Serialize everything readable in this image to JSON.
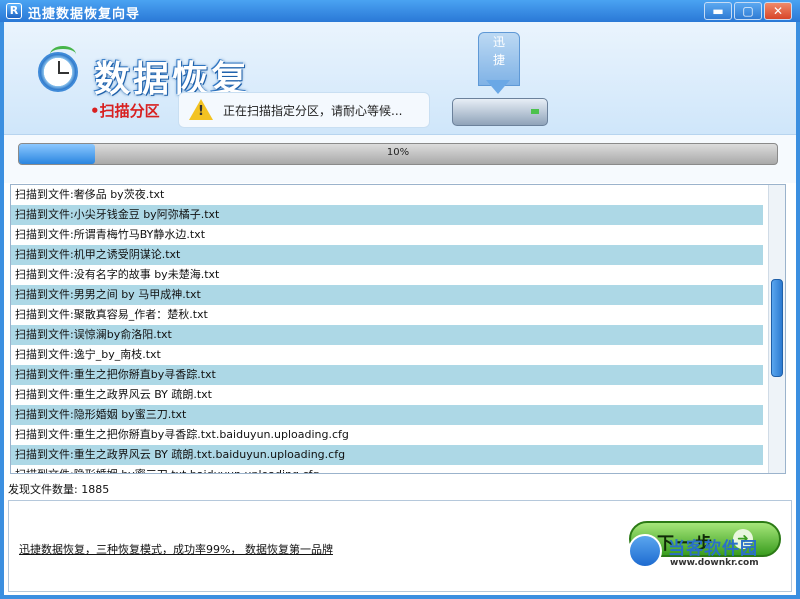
{
  "window": {
    "title": "迅捷数据恢复向导",
    "icon_letter": "R",
    "controls": {
      "minimize": "▬",
      "maximize": "▢",
      "close": "✕"
    }
  },
  "header": {
    "big_title": "数据恢复",
    "sub_title": "•扫描分区",
    "status_message": "正在扫描指定分区，请耐心等候...",
    "drive_sign": "迅\n捷"
  },
  "progress": {
    "value": 0.1,
    "label": "10%"
  },
  "log": {
    "rows": [
      "扫描到文件:奢侈品 by茨夜.txt",
      "扫描到文件:小尖牙钱金豆 by阿弥橘子.txt",
      "扫描到文件:所谓青梅竹马BY静水边.txt",
      "扫描到文件:机甲之诱受阴谋论.txt",
      "扫描到文件:没有名字的故事 by未楚海.txt",
      "扫描到文件:男男之间 by 马甲成神.txt",
      "扫描到文件:聚散真容易_作者：楚秋.txt",
      "扫描到文件:误惊澜by俞洛阳.txt",
      "扫描到文件:逸宁_by_南枝.txt",
      "扫描到文件:重生之把你掰直by寻香踪.txt",
      "扫描到文件:重生之政界风云 BY  疏朗.txt",
      "扫描到文件:隐形婚姻 by蜜三刀.txt",
      "扫描到文件:重生之把你掰直by寻香踪.txt.baiduyun.uploading.cfg",
      "扫描到文件:重生之政界风云 BY  疏朗.txt.baiduyun.uploading.cfg",
      "扫描到文件:隐形婚姻 by蜜三刀.txt.baiduyun.uploading.cfg"
    ]
  },
  "found_count": {
    "label": "发现文件数量:",
    "value": "1885"
  },
  "footer": {
    "slogan": "迅捷数据恢复，三种恢复模式，成功率99%， 数据恢复第一品牌",
    "next_label": "下一步",
    "next_icon": "➜"
  },
  "watermark": {
    "text": "当客软件园",
    "url": "www.downkr.com"
  },
  "colors": {
    "titlebar": "#2a78d6",
    "row_alt": "#add8e6",
    "progress": "#2a85e0",
    "next_button": "#3a9d1f",
    "subtitle": "#d82020"
  }
}
